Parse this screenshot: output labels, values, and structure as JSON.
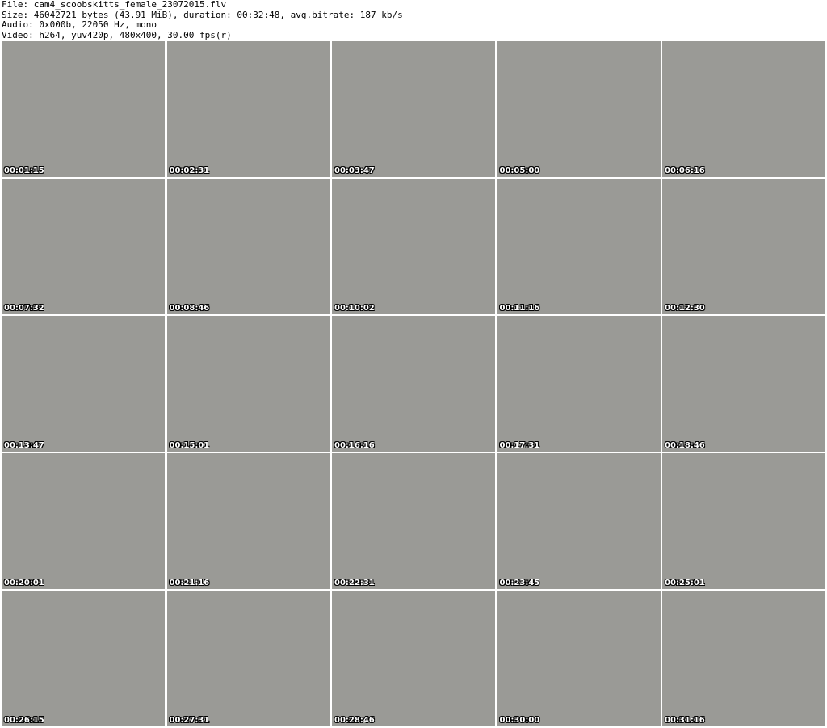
{
  "header": {
    "file": "File: cam4_scoobskitts_female_23072015.flv",
    "size": "Size: 46042721 bytes (43.91 MiB), duration: 00:32:48, avg.bitrate: 187 kb/s",
    "audio": "Audio: 0x000b, 22050 Hz, mono",
    "video": "Video: h264, yuv420p, 480x400, 30.00 fps(r)"
  },
  "thumbnails": [
    "00:01:15",
    "00:02:31",
    "00:03:47",
    "00:05:00",
    "00:06:16",
    "00:07:32",
    "00:08:46",
    "00:10:02",
    "00:11:16",
    "00:12:30",
    "00:13:47",
    "00:15:01",
    "00:16:16",
    "00:17:31",
    "00:18:46",
    "00:20:01",
    "00:21:16",
    "00:22:31",
    "00:23:45",
    "00:25:01",
    "00:26:15",
    "00:27:31",
    "00:28:46",
    "00:30:00",
    "00:31:16"
  ]
}
